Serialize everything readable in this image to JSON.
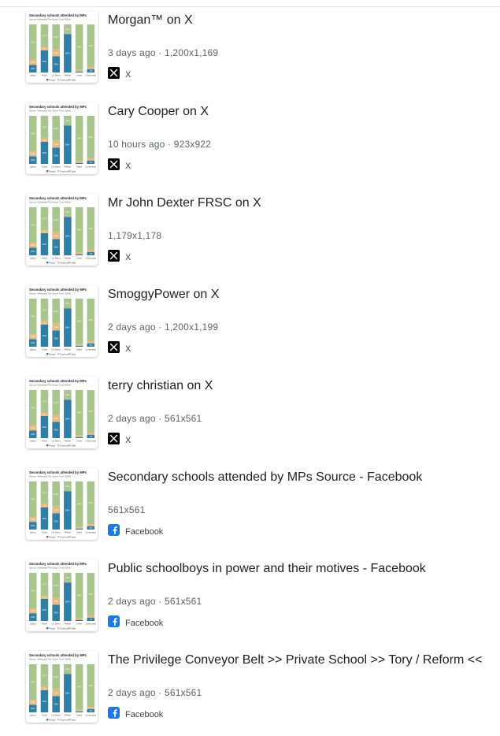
{
  "thumbnail": {
    "title": "Secondary schools attended by MPs",
    "subtitle": "Source: Wikipedia/The Sutton Trust (2024)",
    "categories": [
      "Labour",
      "Tories",
      "Lib Dems",
      "Reform",
      "Green",
      "Cross-party"
    ],
    "series": [
      {
        "name": "Private",
        "color": "#2e7fa7",
        "values": [
          16,
          46,
          34,
          80,
          2,
          7
        ]
      },
      {
        "name": "Grammar",
        "color": "#e9b87a",
        "values": [
          10,
          7,
          14,
          0,
          4,
          4
        ]
      },
      {
        "name": "State",
        "color": "#a8c58b",
        "values": [
          74,
          47,
          52,
          20,
          94,
          89
        ]
      }
    ]
  },
  "results": [
    {
      "title": "Morgan™ on X",
      "meta": "3 days ago · 1,200x1,169",
      "source": "X",
      "source_icon": "x-logo-icon"
    },
    {
      "title": "Cary Cooper on X",
      "meta": "10 hours ago · 923x922",
      "source": "X",
      "source_icon": "x-logo-icon"
    },
    {
      "title": "Mr John Dexter FRSC on X",
      "meta": "1,179x1,178",
      "source": "X",
      "source_icon": "x-logo-icon"
    },
    {
      "title": "SmoggyPower on X",
      "meta": "2 days ago · 1,200x1,199",
      "source": "X",
      "source_icon": "x-logo-icon"
    },
    {
      "title": "terry christian on X",
      "meta": "2 days ago · 561x561",
      "source": "X",
      "source_icon": "x-logo-icon"
    },
    {
      "title": "Secondary schools attended by MPs Source - Facebook",
      "meta": "561x561",
      "source": "Facebook",
      "source_icon": "facebook-logo-icon"
    },
    {
      "title": "Public schoolboys in power and their motives - Facebook",
      "meta": "2 days ago · 561x561",
      "source": "Facebook",
      "source_icon": "facebook-logo-icon"
    },
    {
      "title": "The Privilege Conveyor Belt >> Private School >> Tory / Reform <<",
      "meta": "2 days ago · 561x561",
      "source": "Facebook",
      "source_icon": "facebook-logo-icon"
    }
  ]
}
